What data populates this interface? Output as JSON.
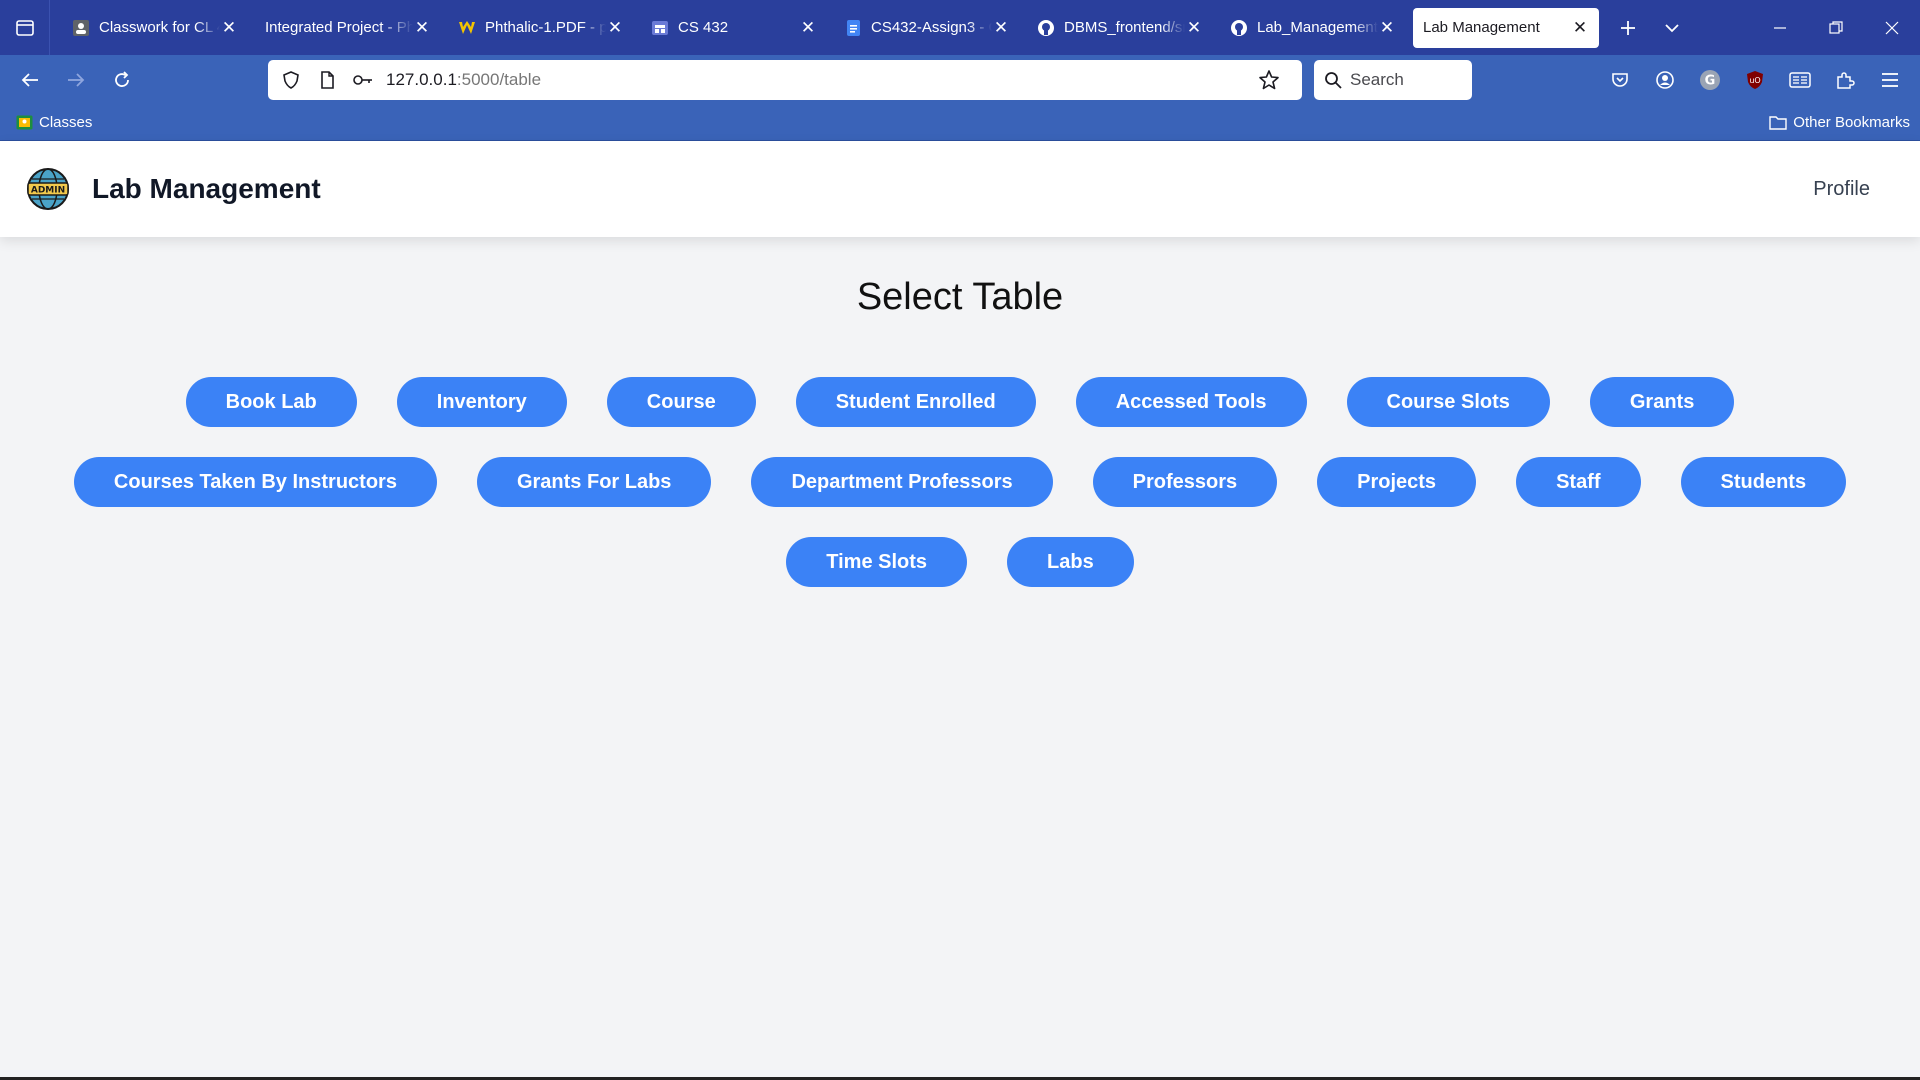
{
  "browser": {
    "tabs": [
      {
        "title": "Classwork for CL 4",
        "icon": "classroom-icon",
        "active": false
      },
      {
        "title": "Integrated Project - Ph",
        "icon": "none",
        "active": false
      },
      {
        "title": "Phthalic-1.PDF - p",
        "icon": "wvu-icon",
        "active": false
      },
      {
        "title": "CS 432",
        "icon": "calendar-icon",
        "active": false
      },
      {
        "title": "CS432-Assign3 - G",
        "icon": "google-docs-icon",
        "active": false
      },
      {
        "title": "DBMS_frontend/sr",
        "icon": "github-icon",
        "active": false
      },
      {
        "title": "Lab_Management",
        "icon": "github-icon",
        "active": false
      },
      {
        "title": "Lab Management",
        "icon": "none",
        "active": true
      }
    ],
    "url_host": "127.0.0.1",
    "url_path": ":5000/table",
    "search_placeholder": "Search",
    "bookmarks": {
      "classes": "Classes",
      "other": "Other Bookmarks"
    }
  },
  "app": {
    "brand": "Lab Management",
    "profile": "Profile",
    "page_title": "Select Table",
    "buttons": [
      "Book Lab",
      "Inventory",
      "Course",
      "Student Enrolled",
      "Accessed Tools",
      "Course Slots",
      "Grants",
      "Courses Taken By Instructors",
      "Grants For Labs",
      "Department Professors",
      "Professors",
      "Projects",
      "Staff",
      "Students",
      "Time Slots",
      "Labs"
    ]
  },
  "colors": {
    "tabbar": "#2a3f9c",
    "toolbar": "#3a63b8",
    "button": "#3b82f6",
    "page_bg": "#f3f4f6"
  }
}
